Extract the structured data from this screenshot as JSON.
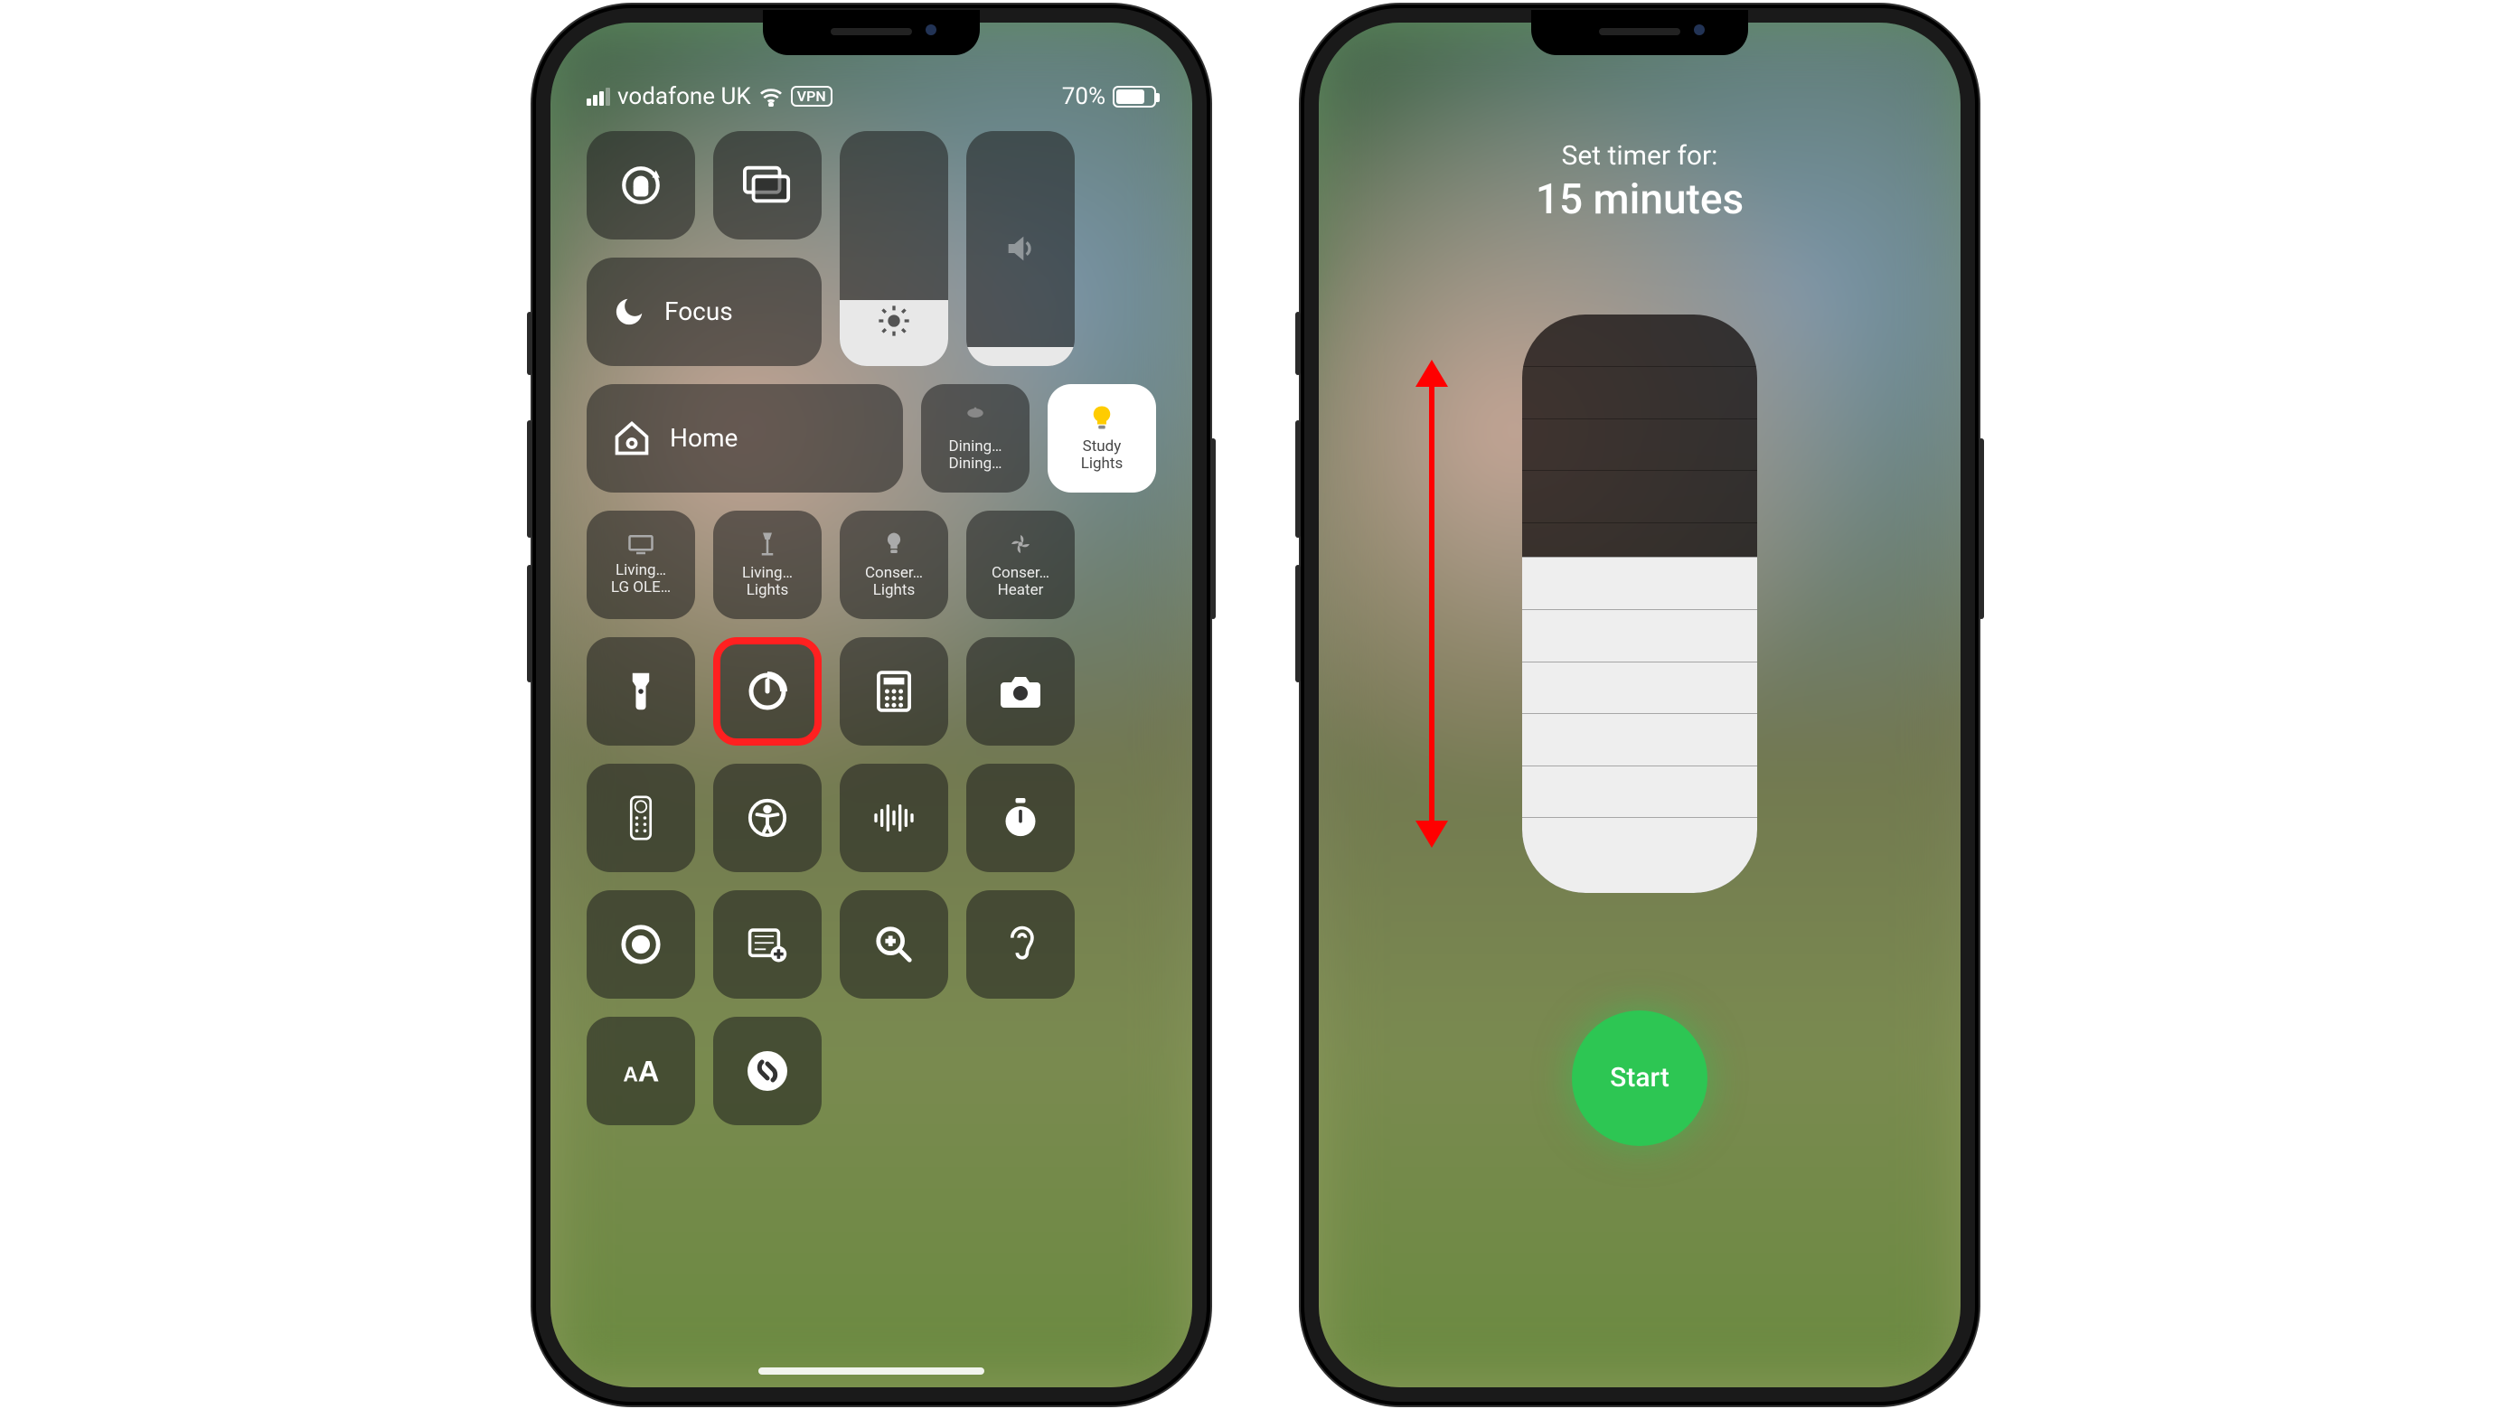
{
  "status": {
    "carrier": "vodafone UK",
    "vpn": "VPN",
    "battery_percent": "70%"
  },
  "controls": {
    "focus_label": "Focus",
    "home_label": "Home",
    "dining": {
      "line1": "Dining…",
      "line2": "Dining…"
    },
    "study_lights": {
      "line1": "Study",
      "line2": "Lights"
    },
    "living_tv": {
      "line1": "Living…",
      "line2": "LG OLE…"
    },
    "living_lights": {
      "line1": "Living…",
      "line2": "Lights"
    },
    "conser_lights": {
      "line1": "Conser…",
      "line2": "Lights"
    },
    "conser_heater": {
      "line1": "Conser…",
      "line2": "Heater"
    }
  },
  "timer": {
    "set_label": "Set timer for:",
    "duration": "15 minutes",
    "start_label": "Start",
    "fill_percent": 58
  }
}
